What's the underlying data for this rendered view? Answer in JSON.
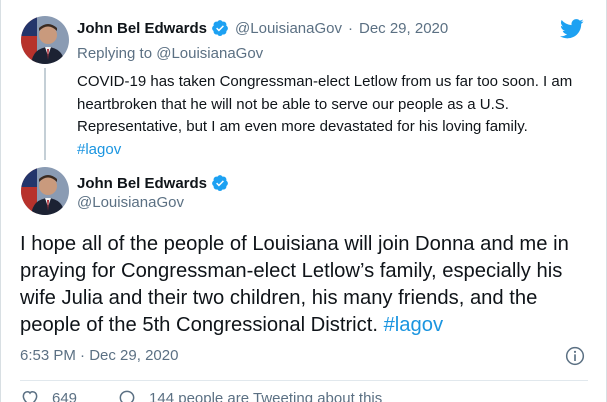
{
  "colors": {
    "text": "#0f1419",
    "muted": "#5b7083",
    "hashtag": "#1b95e0",
    "twitter_blue": "#1da1f2",
    "verified": "#1da1f2",
    "thread_line": "#c4cfd6"
  },
  "reply_tweet": {
    "name": "John Bel Edwards",
    "handle": "@LouisianaGov",
    "separator": "·",
    "date": "Dec 29, 2020",
    "replying_label": "Replying to",
    "replying_to": "@LouisianaGov",
    "text": "COVID-19 has taken Congressman-elect Letlow from us far too soon. I am heartbroken that he will not be able to serve our people as a U.S. Representative, but I am even more devastated for his loving family.",
    "hashtag": "#lagov"
  },
  "main_tweet": {
    "name": "John Bel Edwards",
    "handle": "@LouisianaGov",
    "text": "I hope all of the people of Louisiana will join Donna and me in praying for Congressman-elect Letlow’s family, especially his wife Julia and their two children, his many friends, and the people of the 5th Congressional District.",
    "hashtag": "#lagov",
    "time": "6:53 PM",
    "separator": "·",
    "date": "Dec 29, 2020"
  },
  "actions": {
    "like_count": "649",
    "reply_text": "144 people are Tweeting about this"
  },
  "icons": {
    "verified": "verified-badge-icon",
    "bird": "twitter-bird-icon",
    "info": "info-icon",
    "heart": "heart-icon",
    "reply": "reply-bubble-icon"
  }
}
